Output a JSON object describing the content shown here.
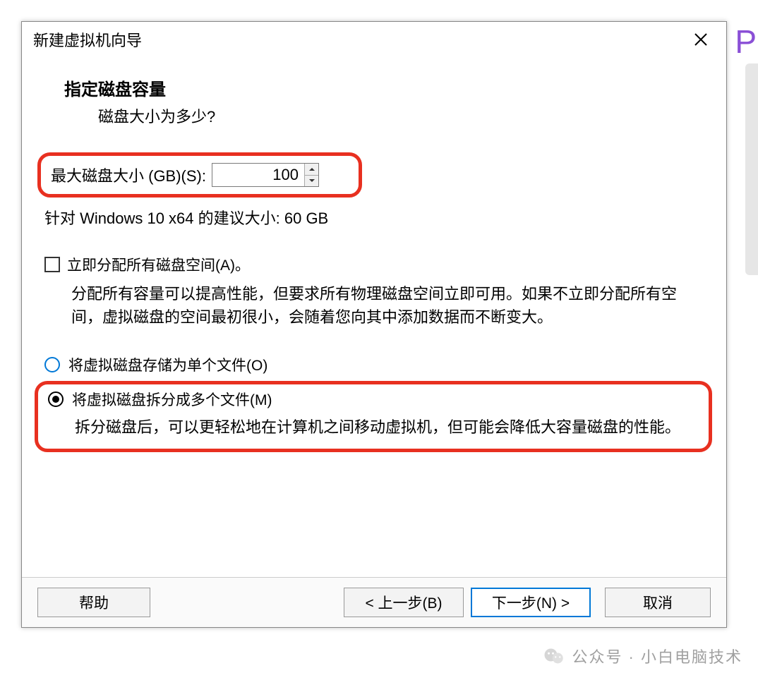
{
  "dialog": {
    "title": "新建虚拟机向导",
    "header_title": "指定磁盘容量",
    "header_sub": "磁盘大小为多少?"
  },
  "disk": {
    "label": "最大磁盘大小 (GB)(S):",
    "value": "100",
    "recommend": "针对 Windows 10 x64 的建议大小: 60 GB"
  },
  "allocate": {
    "label": "立即分配所有磁盘空间(A)。",
    "desc": "分配所有容量可以提高性能，但要求所有物理磁盘空间立即可用。如果不立即分配所有空间，虚拟磁盘的空间最初很小，会随着您向其中添加数据而不断变大。"
  },
  "radios": {
    "single": "将虚拟磁盘存储为单个文件(O)",
    "split": "将虚拟磁盘拆分成多个文件(M)",
    "split_desc": "拆分磁盘后，可以更轻松地在计算机之间移动虚拟机，但可能会降低大容量磁盘的性能。"
  },
  "buttons": {
    "help": "帮助",
    "back": "< 上一步(B)",
    "next": "下一步(N) >",
    "cancel": "取消"
  },
  "watermark": {
    "text": "公众号 · 小白电脑技术"
  },
  "bg": {
    "p": "P"
  }
}
